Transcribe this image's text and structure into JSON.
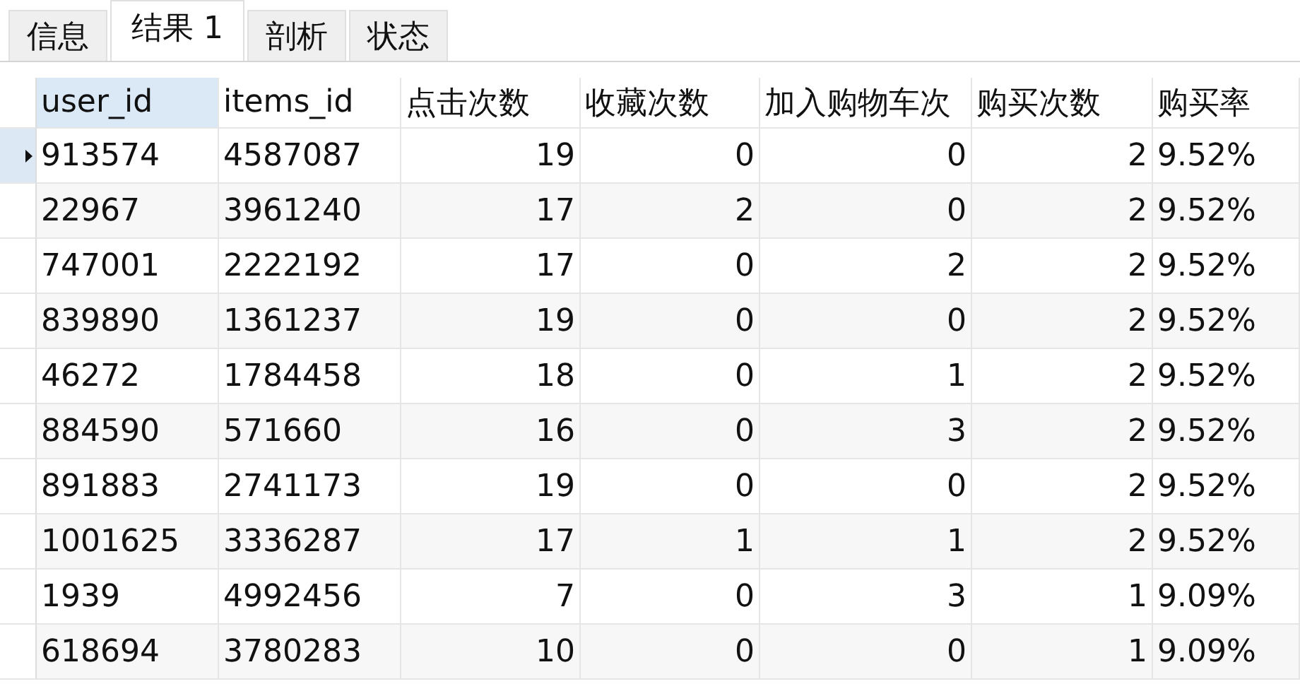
{
  "tabs": [
    {
      "label": "信息",
      "selected": false
    },
    {
      "label": "结果 1",
      "selected": true
    },
    {
      "label": "剖析",
      "selected": false
    },
    {
      "label": "状态",
      "selected": false
    }
  ],
  "table": {
    "columns": [
      {
        "label": "user_id",
        "kind": "text",
        "selected": true
      },
      {
        "label": "items_id",
        "kind": "text",
        "selected": false
      },
      {
        "label": "点击次数",
        "kind": "number",
        "selected": false
      },
      {
        "label": "收藏次数",
        "kind": "number",
        "selected": false
      },
      {
        "label": "加入购物车次",
        "kind": "number",
        "selected": false
      },
      {
        "label": "购买次数",
        "kind": "number",
        "selected": false
      },
      {
        "label": "购买率",
        "kind": "text",
        "selected": false
      }
    ],
    "rows": [
      {
        "selected": true,
        "cells": [
          "913574",
          "4587087",
          "19",
          "0",
          "0",
          "2",
          "9.52%"
        ]
      },
      {
        "selected": false,
        "cells": [
          "22967",
          "3961240",
          "17",
          "2",
          "0",
          "2",
          "9.52%"
        ]
      },
      {
        "selected": false,
        "cells": [
          "747001",
          "2222192",
          "17",
          "0",
          "2",
          "2",
          "9.52%"
        ]
      },
      {
        "selected": false,
        "cells": [
          "839890",
          "1361237",
          "19",
          "0",
          "0",
          "2",
          "9.52%"
        ]
      },
      {
        "selected": false,
        "cells": [
          "46272",
          "1784458",
          "18",
          "0",
          "1",
          "2",
          "9.52%"
        ]
      },
      {
        "selected": false,
        "cells": [
          "884590",
          "571660",
          "16",
          "0",
          "3",
          "2",
          "9.52%"
        ]
      },
      {
        "selected": false,
        "cells": [
          "891883",
          "2741173",
          "19",
          "0",
          "0",
          "2",
          "9.52%"
        ]
      },
      {
        "selected": false,
        "cells": [
          "1001625",
          "3336287",
          "17",
          "1",
          "1",
          "2",
          "9.52%"
        ]
      },
      {
        "selected": false,
        "cells": [
          "1939",
          "4992456",
          "7",
          "0",
          "3",
          "1",
          "9.09%"
        ]
      },
      {
        "selected": false,
        "cells": [
          "618694",
          "3780283",
          "10",
          "0",
          "0",
          "1",
          "9.09%"
        ]
      }
    ]
  }
}
